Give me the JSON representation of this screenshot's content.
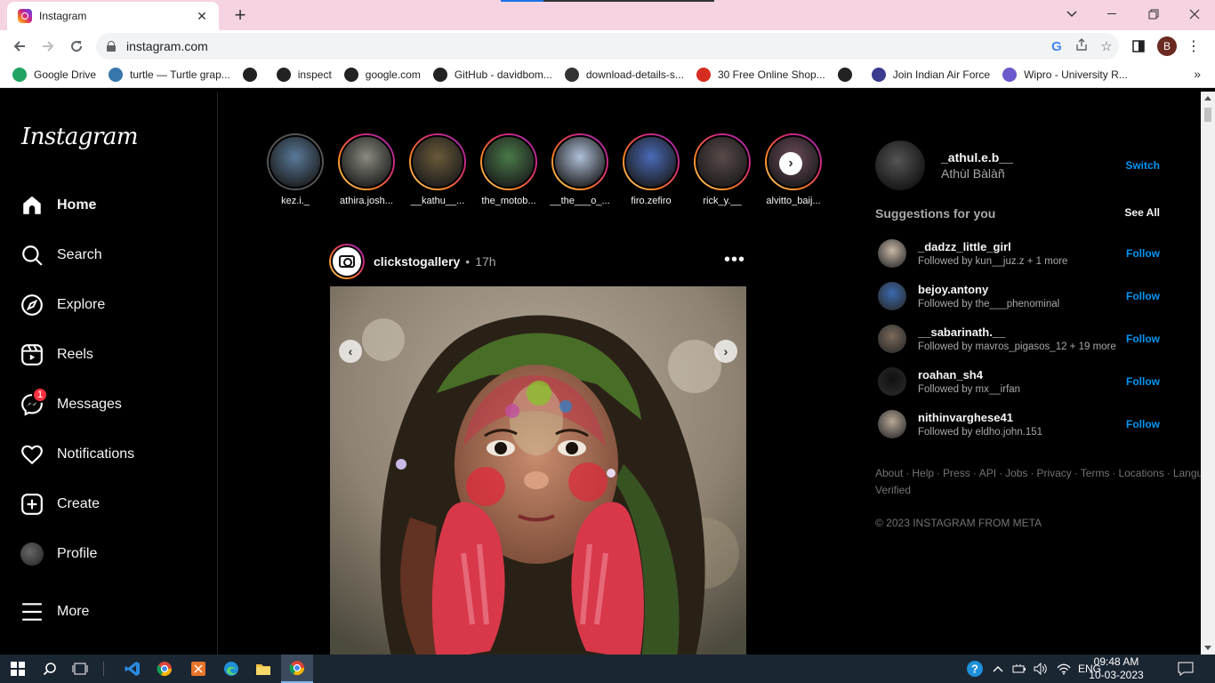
{
  "browser": {
    "tab_title": "Instagram",
    "url": "instagram.com",
    "profile_initial": "B",
    "bookmarks": [
      {
        "label": "Google Drive",
        "icon": "drive-icon",
        "color": "#1fa463"
      },
      {
        "label": "turtle — Turtle grap...",
        "icon": "python-icon",
        "color": "#3776ab"
      },
      {
        "label": "",
        "icon": "globe-icon",
        "color": "#222222"
      },
      {
        "label": "inspect",
        "icon": "globe-icon",
        "color": "#222222"
      },
      {
        "label": "google.com",
        "icon": "globe-icon",
        "color": "#222222"
      },
      {
        "label": "GitHub - davidbom...",
        "icon": "github-icon",
        "color": "#222222"
      },
      {
        "label": "download-details-s...",
        "icon": "s-icon",
        "color": "#333333"
      },
      {
        "label": "30 Free Online Shop...",
        "icon": "b-icon",
        "color": "#d62d20"
      },
      {
        "label": "",
        "icon": "globe-icon",
        "color": "#222222"
      },
      {
        "label": "Join Indian Air Force",
        "icon": "airforce-icon",
        "color": "#3b3b8f"
      },
      {
        "label": "Wipro - University R...",
        "icon": "wipro-icon",
        "color": "#6a5acd"
      }
    ]
  },
  "sidebar": {
    "logo": "Instagram",
    "items": [
      {
        "label": "Home",
        "icon": "home-icon",
        "bold": true
      },
      {
        "label": "Search",
        "icon": "search-icon"
      },
      {
        "label": "Explore",
        "icon": "compass-icon"
      },
      {
        "label": "Reels",
        "icon": "reels-icon"
      },
      {
        "label": "Messages",
        "icon": "messenger-icon",
        "badge": "1"
      },
      {
        "label": "Notifications",
        "icon": "heart-icon"
      },
      {
        "label": "Create",
        "icon": "plus-square-icon"
      },
      {
        "label": "Profile",
        "icon": "profile-avatar"
      },
      {
        "label": "More",
        "icon": "hamburger-icon"
      }
    ]
  },
  "stories": [
    {
      "name": "kez.i._",
      "seen": true,
      "color": "#5a7a9a"
    },
    {
      "name": "athira.josh...",
      "seen": false,
      "color": "#8a8a80"
    },
    {
      "name": "__kathu__...",
      "seen": false,
      "color": "#6b5a3a"
    },
    {
      "name": "the_motob...",
      "seen": false,
      "color": "#4a7a4a"
    },
    {
      "name": "__the___o_...",
      "seen": false,
      "color": "#b0c0d8"
    },
    {
      "name": "firo.zefiro",
      "seen": false,
      "color": "#4a6ab8"
    },
    {
      "name": "rick_y.__",
      "seen": false,
      "color": "#5a4a4a"
    },
    {
      "name": "alvitto_baij...",
      "seen": false,
      "color": "#6a4a5a"
    }
  ],
  "post": {
    "username": "clickstogallery",
    "time": "17h"
  },
  "account": {
    "username": "_athul.e.b__",
    "display_name": "Athùl Bàlàñ",
    "switch_label": "Switch"
  },
  "suggestions": {
    "title": "Suggestions for you",
    "see_all": "See All",
    "follow_label": "Follow",
    "items": [
      {
        "username": "_dadzz_little_girl",
        "sub": "Followed by kun__juz.z + 1 more",
        "color": "#c8b8a8"
      },
      {
        "username": "bejoy.antony",
        "sub": "Followed by the___phenominal",
        "color": "#3a6ab0"
      },
      {
        "username": "__sabarinath.__",
        "sub": "Followed by mavros_pigasos_12 + 19 more",
        "color": "#7a6a5a"
      },
      {
        "username": "roahan_sh4",
        "sub": "Followed by mx__irfan",
        "color": "#111111"
      },
      {
        "username": "nithinvarghese41",
        "sub": "Followed by eldho.john.151",
        "color": "#b8a898"
      }
    ]
  },
  "footer": {
    "links": [
      "About",
      "Help",
      "Press",
      "API",
      "Jobs",
      "Privacy",
      "Terms",
      "Locations",
      "Language",
      "Meta Verified"
    ],
    "copyright": "© 2023 INSTAGRAM FROM META"
  },
  "taskbar": {
    "language": "ENG",
    "time": "09:48 AM",
    "date": "10-03-2023"
  }
}
